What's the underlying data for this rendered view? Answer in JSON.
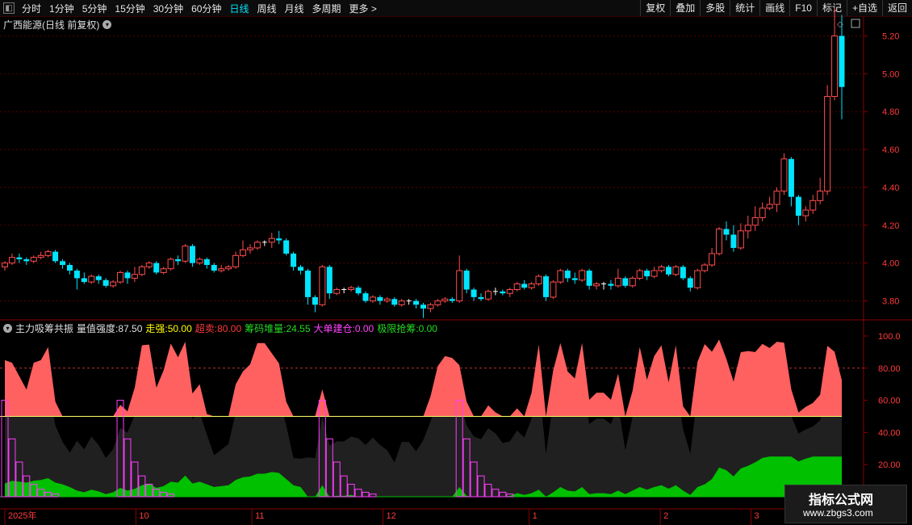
{
  "toolbar": {
    "periods": [
      "分时",
      "1分钟",
      "5分钟",
      "15分钟",
      "30分钟",
      "60分钟",
      "日线",
      "周线",
      "月线",
      "多周期",
      "更多 >"
    ],
    "active_period": "日线",
    "right_buttons": [
      "复权",
      "叠加",
      "多股",
      "统计",
      "画线",
      "F10",
      "标记",
      "+自选",
      "返回"
    ]
  },
  "main_chart": {
    "title": "广西能源(日线 前复权)",
    "y_ticks": [
      "5.20",
      "5.00",
      "4.80",
      "4.60",
      "4.40",
      "4.20",
      "4.00",
      "3.80"
    ]
  },
  "indicator": {
    "name": "主力吸筹共振",
    "items": [
      {
        "label": "量值强度:",
        "value": "87.50",
        "color": "#e0e0e0"
      },
      {
        "label": "走强:",
        "value": "50.00",
        "color": "#ffff00"
      },
      {
        "label": "超卖:",
        "value": "80.00",
        "color": "#ff3b3b"
      },
      {
        "label": "筹码堆量:",
        "value": "24.55",
        "color": "#22dd22"
      },
      {
        "label": "大单建仓:",
        "value": "0.00",
        "color": "#ff44ff"
      },
      {
        "label": "极限抢筹:",
        "value": "0.00",
        "color": "#22dd22"
      }
    ],
    "y_ticks": [
      "100.0",
      "80.00",
      "60.00",
      "40.00",
      "20.00"
    ]
  },
  "x_axis": [
    "2025年",
    "10",
    "11",
    "12",
    "1",
    "2",
    "3"
  ],
  "watermark": {
    "title": "指标公式网",
    "url": "www.zbgs3.com"
  },
  "colors": {
    "up": "#ff4d4d",
    "down": "#00e5ff",
    "area_red": "#ff6060",
    "area_dark": "#202020",
    "green": "#00c000",
    "magenta": "#ff3cff"
  },
  "chart_data": {
    "type": "candlestick",
    "title": "广西能源(日线 前复权)",
    "ylim": [
      3.7,
      5.3
    ],
    "candles": [
      [
        3.98,
        4.0,
        3.96,
        4.01
      ],
      [
        4.0,
        4.03,
        3.99,
        4.05
      ],
      [
        4.03,
        4.02,
        4.0,
        4.05
      ],
      [
        4.02,
        4.01,
        3.99,
        4.03
      ],
      [
        4.01,
        4.03,
        4.0,
        4.04
      ],
      [
        4.03,
        4.04,
        4.02,
        4.06
      ],
      [
        4.04,
        4.06,
        4.03,
        4.07
      ],
      [
        4.06,
        4.01,
        4.0,
        4.07
      ],
      [
        4.01,
        3.99,
        3.97,
        4.02
      ],
      [
        3.99,
        3.96,
        3.94,
        4.0
      ],
      [
        3.96,
        3.92,
        3.86,
        3.97
      ],
      [
        3.92,
        3.9,
        3.89,
        3.95
      ],
      [
        3.9,
        3.93,
        3.89,
        3.94
      ],
      [
        3.93,
        3.91,
        3.89,
        3.94
      ],
      [
        3.91,
        3.88,
        3.87,
        3.92
      ],
      [
        3.88,
        3.9,
        3.87,
        3.91
      ],
      [
        3.9,
        3.95,
        3.89,
        3.96
      ],
      [
        3.95,
        3.92,
        3.89,
        3.96
      ],
      [
        3.92,
        3.94,
        3.9,
        3.98
      ],
      [
        3.94,
        3.98,
        3.93,
        3.99
      ],
      [
        3.98,
        4.0,
        3.97,
        4.01
      ],
      [
        4.0,
        3.95,
        3.94,
        4.01
      ],
      [
        3.95,
        3.97,
        3.94,
        3.98
      ],
      [
        3.97,
        4.02,
        3.96,
        4.03
      ],
      [
        4.02,
        4.01,
        3.99,
        4.04
      ],
      [
        4.01,
        4.09,
        4.0,
        4.1
      ],
      [
        4.09,
        4.0,
        3.98,
        4.1
      ],
      [
        4.0,
        4.02,
        3.99,
        4.03
      ],
      [
        4.02,
        3.99,
        3.97,
        4.03
      ],
      [
        3.99,
        3.96,
        3.95,
        4.0
      ],
      [
        3.96,
        3.97,
        3.95,
        3.99
      ],
      [
        3.97,
        3.98,
        3.96,
        3.99
      ],
      [
        3.98,
        4.04,
        3.97,
        4.06
      ],
      [
        4.04,
        4.07,
        4.03,
        4.12
      ],
      [
        4.07,
        4.08,
        4.05,
        4.1
      ],
      [
        4.08,
        4.11,
        4.07,
        4.12
      ],
      [
        4.11,
        4.11,
        4.09,
        4.12
      ],
      [
        4.11,
        4.13,
        4.08,
        4.16
      ],
      [
        4.13,
        4.12,
        4.1,
        4.17
      ],
      [
        4.12,
        4.05,
        4.04,
        4.13
      ],
      [
        4.05,
        3.98,
        3.96,
        4.06
      ],
      [
        3.98,
        3.96,
        3.94,
        3.99
      ],
      [
        3.96,
        3.82,
        3.78,
        3.97
      ],
      [
        3.82,
        3.78,
        3.74,
        3.83
      ],
      [
        3.78,
        3.98,
        3.77,
        3.99
      ],
      [
        3.98,
        3.84,
        3.81,
        3.99
      ],
      [
        3.84,
        3.86,
        3.83,
        3.87
      ],
      [
        3.86,
        3.86,
        3.84,
        3.87
      ],
      [
        3.86,
        3.87,
        3.85,
        3.88
      ],
      [
        3.87,
        3.84,
        3.83,
        3.88
      ],
      [
        3.84,
        3.8,
        3.79,
        3.85
      ],
      [
        3.8,
        3.82,
        3.79,
        3.83
      ],
      [
        3.82,
        3.8,
        3.78,
        3.83
      ],
      [
        3.8,
        3.81,
        3.79,
        3.82
      ],
      [
        3.81,
        3.78,
        3.77,
        3.82
      ],
      [
        3.78,
        3.8,
        3.77,
        3.81
      ],
      [
        3.8,
        3.8,
        3.78,
        3.81
      ],
      [
        3.8,
        3.78,
        3.76,
        3.81
      ],
      [
        3.78,
        3.76,
        3.71,
        3.79
      ],
      [
        3.76,
        3.78,
        3.74,
        3.79
      ],
      [
        3.78,
        3.8,
        3.77,
        3.81
      ],
      [
        3.8,
        3.81,
        3.79,
        3.82
      ],
      [
        3.81,
        3.8,
        3.79,
        3.82
      ],
      [
        3.8,
        3.96,
        3.79,
        4.04
      ],
      [
        3.96,
        3.86,
        3.84,
        3.97
      ],
      [
        3.86,
        3.82,
        3.8,
        3.87
      ],
      [
        3.82,
        3.81,
        3.8,
        3.84
      ],
      [
        3.81,
        3.85,
        3.8,
        3.86
      ],
      [
        3.85,
        3.85,
        3.83,
        3.87
      ],
      [
        3.85,
        3.84,
        3.83,
        3.86
      ],
      [
        3.84,
        3.86,
        3.82,
        3.87
      ],
      [
        3.86,
        3.89,
        3.85,
        3.9
      ],
      [
        3.89,
        3.87,
        3.86,
        3.91
      ],
      [
        3.87,
        3.89,
        3.86,
        3.9
      ],
      [
        3.89,
        3.93,
        3.88,
        3.94
      ],
      [
        3.93,
        3.82,
        3.8,
        3.94
      ],
      [
        3.82,
        3.9,
        3.81,
        3.91
      ],
      [
        3.9,
        3.96,
        3.89,
        3.97
      ],
      [
        3.96,
        3.92,
        3.9,
        3.97
      ],
      [
        3.92,
        3.91,
        3.89,
        3.95
      ],
      [
        3.91,
        3.96,
        3.9,
        3.97
      ],
      [
        3.96,
        3.88,
        3.86,
        3.97
      ],
      [
        3.88,
        3.89,
        3.86,
        3.9
      ],
      [
        3.89,
        3.89,
        3.86,
        3.9
      ],
      [
        3.89,
        3.88,
        3.86,
        3.91
      ],
      [
        3.88,
        3.92,
        3.87,
        3.97
      ],
      [
        3.92,
        3.88,
        3.87,
        3.93
      ],
      [
        3.88,
        3.92,
        3.87,
        3.93
      ],
      [
        3.92,
        3.96,
        3.91,
        3.97
      ],
      [
        3.96,
        3.93,
        3.91,
        3.97
      ],
      [
        3.93,
        3.96,
        3.92,
        3.98
      ],
      [
        3.96,
        3.98,
        3.95,
        3.99
      ],
      [
        3.98,
        3.94,
        3.93,
        3.99
      ],
      [
        3.94,
        3.98,
        3.93,
        3.99
      ],
      [
        3.98,
        3.92,
        3.91,
        3.99
      ],
      [
        3.92,
        3.87,
        3.85,
        3.93
      ],
      [
        3.87,
        3.96,
        3.86,
        3.97
      ],
      [
        3.96,
        3.99,
        3.95,
        4.0
      ],
      [
        3.99,
        4.05,
        3.98,
        4.08
      ],
      [
        4.05,
        4.18,
        4.04,
        4.19
      ],
      [
        4.18,
        4.15,
        4.12,
        4.22
      ],
      [
        4.15,
        4.08,
        4.06,
        4.2
      ],
      [
        4.08,
        4.17,
        4.07,
        4.21
      ],
      [
        4.17,
        4.2,
        4.13,
        4.25
      ],
      [
        4.2,
        4.24,
        4.17,
        4.3
      ],
      [
        4.24,
        4.29,
        4.22,
        4.32
      ],
      [
        4.29,
        4.31,
        4.28,
        4.35
      ],
      [
        4.31,
        4.38,
        4.27,
        4.4
      ],
      [
        4.38,
        4.55,
        4.36,
        4.58
      ],
      [
        4.55,
        4.35,
        4.3,
        4.56
      ],
      [
        4.35,
        4.25,
        4.2,
        4.36
      ],
      [
        4.25,
        4.28,
        4.22,
        4.3
      ],
      [
        4.28,
        4.33,
        4.26,
        4.36
      ],
      [
        4.33,
        4.38,
        4.31,
        4.45
      ],
      [
        4.38,
        4.88,
        4.36,
        4.94
      ],
      [
        4.88,
        5.2,
        4.86,
        5.35
      ],
      [
        5.2,
        4.93,
        4.76,
        5.31
      ]
    ]
  }
}
